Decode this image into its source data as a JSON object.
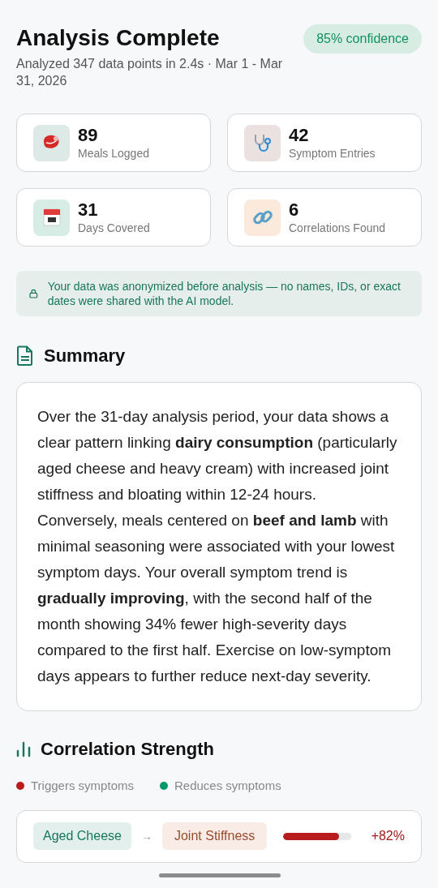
{
  "header": {
    "title": "Analysis Complete",
    "subtitle": "Analyzed 347 data points in 2.4s · Mar 1 - Mar 31, 2026",
    "confidence": "85% confidence"
  },
  "stats": [
    {
      "kind": "meals",
      "value": "89",
      "label": "Meals Logged"
    },
    {
      "kind": "symptoms",
      "value": "42",
      "label": "Symptom Entries"
    },
    {
      "kind": "days",
      "value": "31",
      "label": "Days Covered"
    },
    {
      "kind": "correlations",
      "value": "6",
      "label": "Correlations Found"
    }
  ],
  "privacy_notice": "Your data was anonymized before analysis — no names, IDs, or exact dates were shared with the AI model.",
  "summary": {
    "heading": "Summary",
    "text": "Over the 31-day analysis period, your data shows a clear pattern linking **dairy consumption** (particularly aged cheese and heavy cream) with increased joint stiffness and bloating within 12-24 hours. Conversely, meals centered on **beef and lamb** with minimal seasoning were associated with your lowest symptom days. Your overall symptom trend is **gradually improving**, with the second half of the month showing 34% fewer high-severity days compared to the first half. Exercise on low-symptom days appears to further reduce next-day severity."
  },
  "correlation": {
    "heading": "Correlation Strength",
    "legend": [
      {
        "label": "Triggers symptoms",
        "color": "#b91c1c"
      },
      {
        "label": "Reduces symptoms",
        "color": "#059669"
      }
    ],
    "rows": [
      {
        "kind": "trigger",
        "food": "Aged Cheese",
        "arrow": "→",
        "symptom": "Joint Stiffness",
        "level": 0.82,
        "reading": "+82%"
      }
    ]
  }
}
